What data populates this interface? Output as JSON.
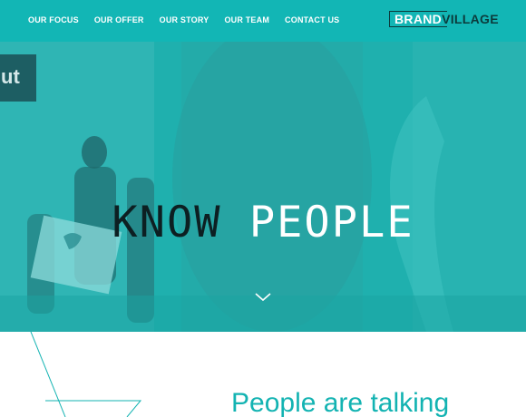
{
  "nav": {
    "items": [
      "OUR FOCUS",
      "OUR OFFER",
      "OUR STORY",
      "OUR TEAM",
      "CONTACT US"
    ]
  },
  "logo": {
    "word1": "BRAND",
    "word2": "VILLAGE"
  },
  "hero": {
    "headline_dark": "KNOW",
    "headline_light": "PEOPLE",
    "sign_text": "ut"
  },
  "section": {
    "heading": "People are talking"
  },
  "colors": {
    "accent": "#12b6b5",
    "hero_overlay": "#1fb0ae",
    "dark": "#0d1f22",
    "heading": "#13b3b2"
  }
}
